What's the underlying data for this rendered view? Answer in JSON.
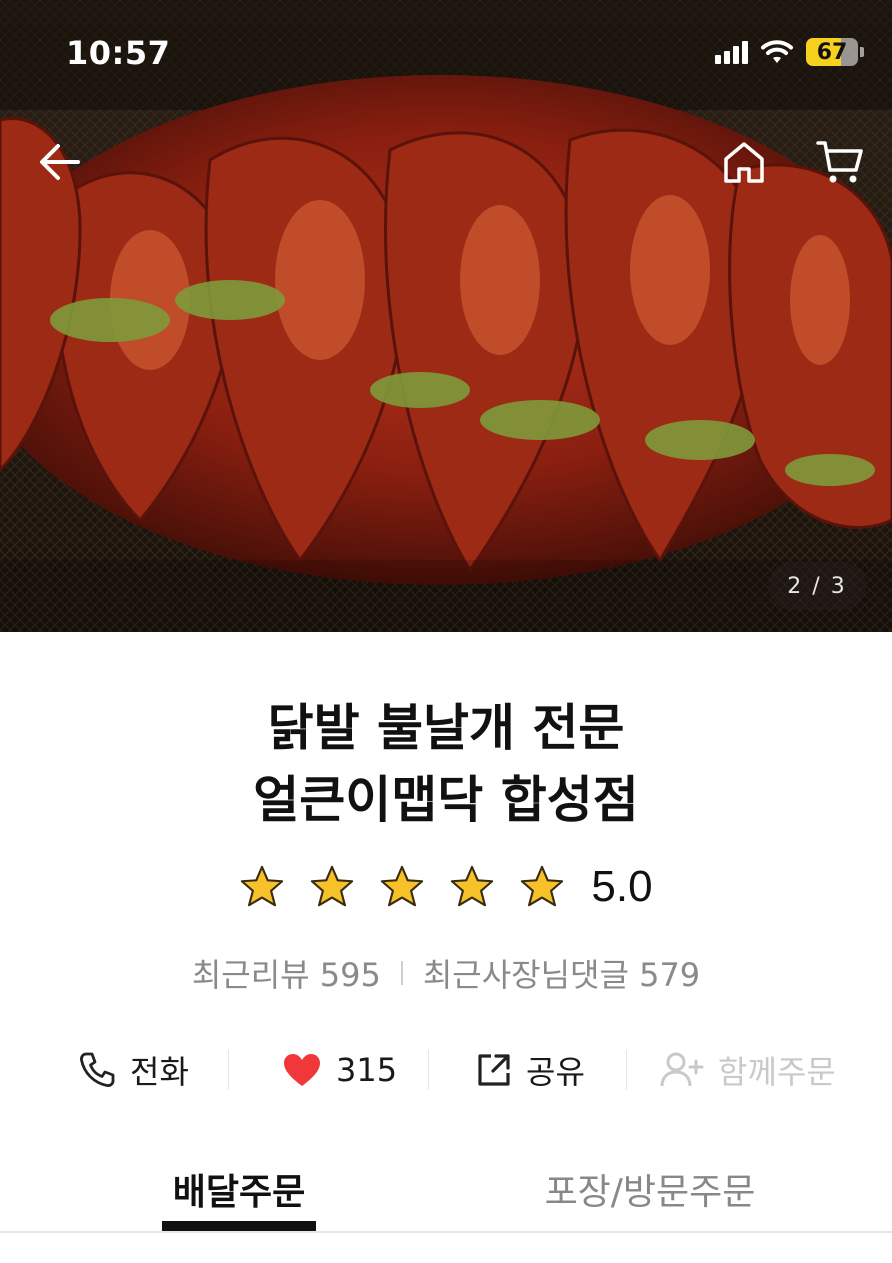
{
  "status_bar": {
    "time": "10:57",
    "battery_percent": "67",
    "battery_level": 0.67,
    "battery_color": "#f6d21f"
  },
  "hero": {
    "image_subject": "spicy glazed chicken feet",
    "page_counter": "2 / 3",
    "icons": [
      "back-arrow-icon",
      "home-icon",
      "cart-icon"
    ]
  },
  "store": {
    "name_line1": "닭발 불날개 전문",
    "name_line2": "얼큰이맵닥 합성점",
    "rating": "5.0",
    "stars": 5,
    "recent_reviews": "최근리뷰 595",
    "recent_owner_replies": "최근사장님댓글 579"
  },
  "actions": {
    "call_label": "전화",
    "like_count": "315",
    "share_label": "공유",
    "group_order_label": "함께주문"
  },
  "tabs": {
    "delivery": "배달주문",
    "pickup": "포장/방문주문"
  },
  "colors": {
    "heart": "#f0383b",
    "star_gold": "#f7c12a",
    "disabled": "#c9c9c9"
  }
}
